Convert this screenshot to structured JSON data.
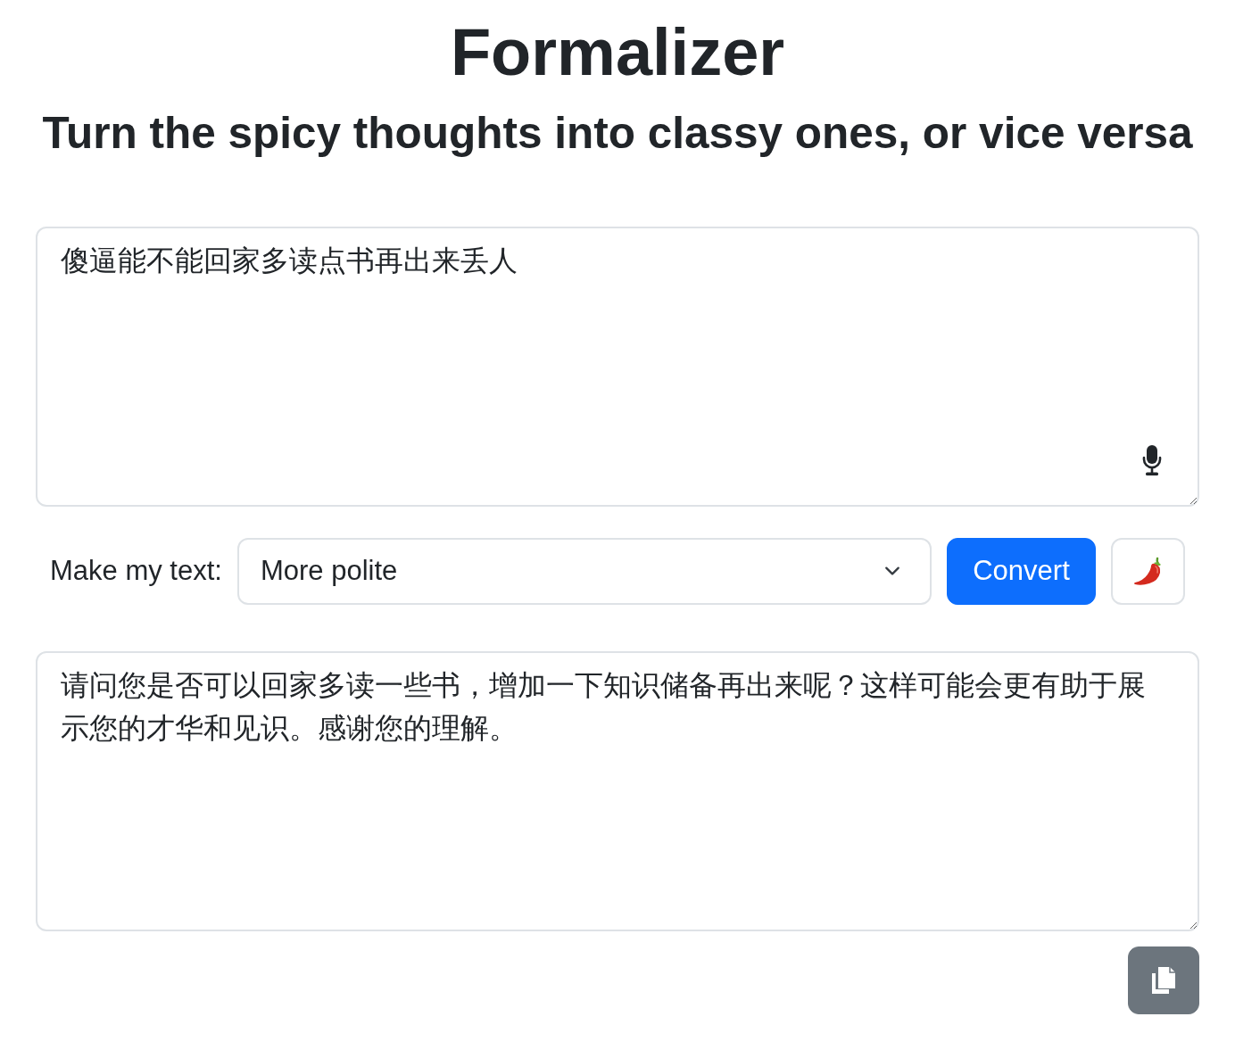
{
  "title": "Formalizer",
  "subtitle": "Turn the spicy thoughts into classy ones, or vice versa",
  "input": {
    "value": "傻逼能不能回家多读点书再出来丢人"
  },
  "controls": {
    "label": "Make my text:",
    "mode": {
      "value": "More polite"
    },
    "convert_button": "Convert"
  },
  "output": {
    "value": "请问您是否可以回家多读一些书，增加一下知识储备再出来呢？这样可能会更有助于展示您的才华和见识。感谢您的理解。"
  }
}
